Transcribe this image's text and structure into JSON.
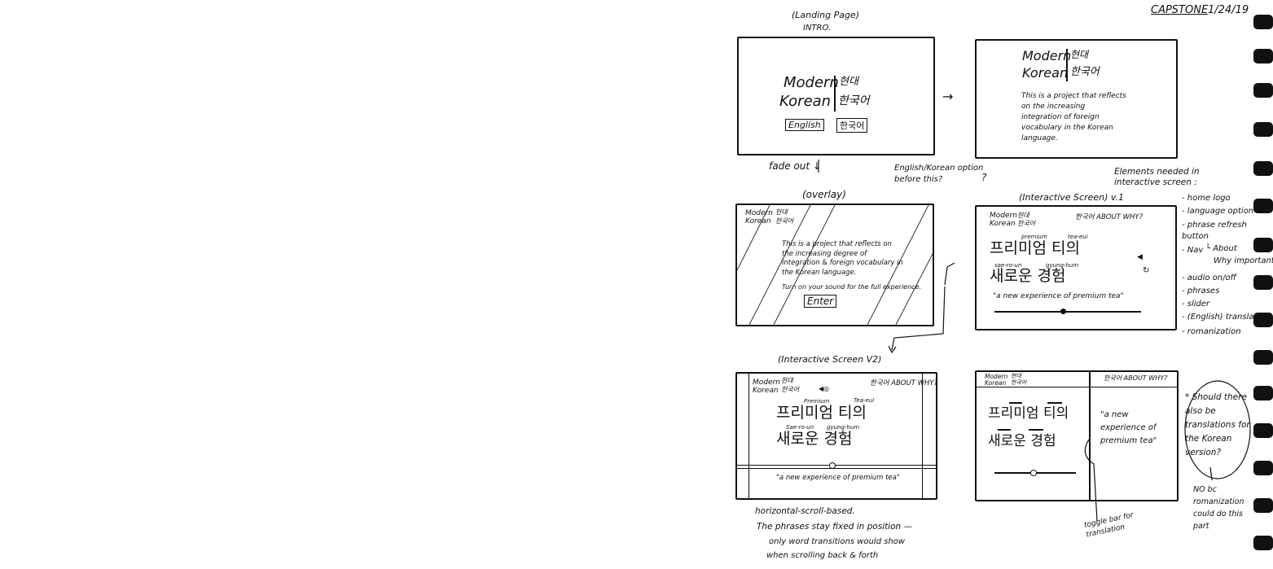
{
  "header": {
    "project": "CAPSTONE",
    "date": "1/24/19"
  },
  "landing": {
    "caption": "(Landing Page)",
    "subcaption": "INTRO.",
    "logo_en_1": "Modern",
    "logo_en_2": "Korean",
    "logo_ko_1": "현대",
    "logo_ko_2": "한국어",
    "btn_english": "English",
    "btn_korean": "한국어"
  },
  "intro_panel": {
    "logo_en_1": "Modern",
    "logo_en_2": "Korean",
    "logo_ko_1": "현대",
    "logo_ko_2": "한국어",
    "description": "This is a project that reflects on the increasing integration of foreign vocabulary in the Korean language."
  },
  "flow": {
    "arrow_right": "→",
    "fade_label": "fade out ↓",
    "question": "English/Korean option before this?",
    "question_mark": "?"
  },
  "overlay": {
    "caption": "(overlay)",
    "logo_en_1": "Modern",
    "logo_en_2": "Korean",
    "logo_ko_1": "현대",
    "logo_ko_2": "한국어",
    "text": "This is a project that reflects on the increasing degree of integration & foreign vocabulary in the Korean language.",
    "sound": "Turn on your sound for the full experience.",
    "enter": "Enter"
  },
  "interactive_v1": {
    "caption": "(Interactive Screen) v.1",
    "logo_en_1": "Modern",
    "logo_en_2": "Korean",
    "logo_ko_1": "현대",
    "logo_ko_2": "한국어",
    "nav": "한국어 ABOUT WHY?",
    "rom_1": "premium",
    "rom_2": "tea-eui",
    "phrase_1": "프리미엄 티의",
    "rom_3": "sae-ro-un",
    "rom_4": "gyung-hum",
    "phrase_2": "새로운 경험",
    "translation": "\"a new experience of premium tea\""
  },
  "elements_needed": {
    "title": "Elements needed in interactive screen :",
    "items": [
      "- home logo",
      "- language option",
      "- phrase refresh button",
      "- Nav",
      "└ About",
      "Why important",
      "- audio on/off",
      "- phrases",
      "- slider",
      "- (English) translation",
      "- romanization"
    ]
  },
  "interactive_v2": {
    "caption": "(Interactive Screen V2)",
    "logo_en_1": "Modern",
    "logo_en_2": "Korean",
    "logo_ko_1": "현대",
    "logo_ko_2": "한국어",
    "icons": "◀◎",
    "nav": "한국어 ABOUT WHY?",
    "rom_1": "Premium",
    "rom_2": "Tea-eui",
    "phrase_1": "프리미엄 티의",
    "rom_3": "Sae-ro-un",
    "rom_4": "gyung-hum",
    "phrase_2": "새로운 경험",
    "translation": "\"a new experience of premium tea\""
  },
  "interactive_v3": {
    "logo_en_1": "Modern",
    "logo_en_2": "Korean",
    "logo_ko_1": "현대",
    "logo_ko_2": "한국어",
    "nav": "한국어 ABOUT WHY?",
    "phrase_1": "프리미엄 티의",
    "phrase_2": "새로운 경험",
    "translation": "\"a new experience of premium tea\""
  },
  "notes": {
    "scroll_1": "horizontal-scroll-based.",
    "scroll_2": "The phrases stay fixed in position —",
    "scroll_3": "only word transitions would show",
    "scroll_4": "when scrolling back & forth",
    "toggle": "toggle bar for translation",
    "question_v3": "* Should there also be translations for the Korean version?",
    "answer": "NO bc romanization could do this part"
  }
}
